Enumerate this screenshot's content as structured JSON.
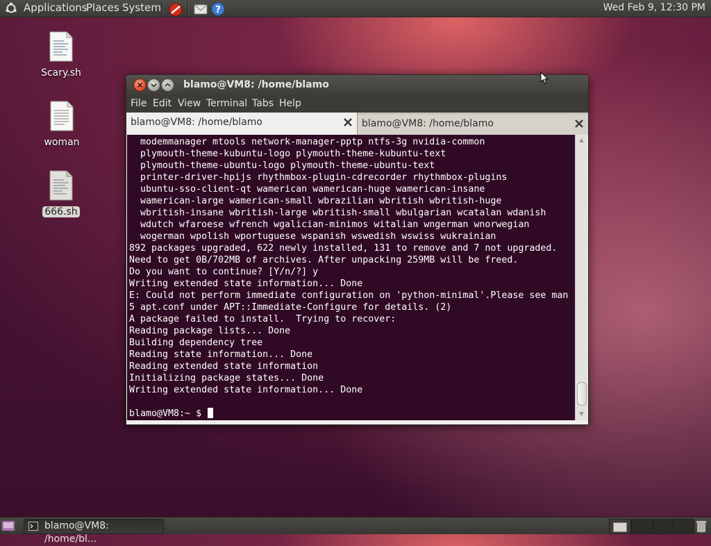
{
  "top_panel": {
    "menus": [
      "Applications",
      "Places",
      "System"
    ],
    "clock": "Wed Feb  9, 12:30 PM",
    "icons": [
      "ubuntu-logo-icon",
      "stop-icon",
      "mail-icon",
      "help-icon"
    ]
  },
  "desktop_icons": [
    {
      "label": "Scary.sh",
      "icon": "script-file-icon"
    },
    {
      "label": "woman",
      "icon": "text-file-icon"
    },
    {
      "label": "666.sh",
      "icon": "script-file-icon",
      "selected": true
    }
  ],
  "terminal_window": {
    "title": "blamo@VM8: /home/blamo",
    "menubar": [
      "File",
      "Edit",
      "View",
      "Terminal",
      "Tabs",
      "Help"
    ],
    "tabs": [
      {
        "label": "blamo@VM8: /home/blamo",
        "active": true
      },
      {
        "label": "blamo@VM8: /home/blamo",
        "active": false
      }
    ],
    "lines": [
      "  modemmanager mtools network-manager-pptp ntfs-3g nvidia-common",
      "  plymouth-theme-kubuntu-logo plymouth-theme-kubuntu-text",
      "  plymouth-theme-ubuntu-logo plymouth-theme-ubuntu-text",
      "  printer-driver-hpijs rhythmbox-plugin-cdrecorder rhythmbox-plugins",
      "  ubuntu-sso-client-qt wamerican wamerican-huge wamerican-insane",
      "  wamerican-large wamerican-small wbrazilian wbritish wbritish-huge",
      "  wbritish-insane wbritish-large wbritish-small wbulgarian wcatalan wdanish",
      "  wdutch wfaroese wfrench wgalician-minimos witalian wngerman wnorwegian",
      "  wogerman wpolish wportuguese wspanish wswedish wswiss wukrainian",
      "892 packages upgraded, 622 newly installed, 131 to remove and 7 not upgraded.",
      "Need to get 0B/702MB of archives. After unpacking 259MB will be freed.",
      "Do you want to continue? [Y/n/?] y",
      "Writing extended state information... Done",
      "E: Could not perform immediate configuration on 'python-minimal'.Please see man",
      "5 apt.conf under APT::Immediate-Configure for details. (2)",
      "A package failed to install.  Trying to recover:",
      "Reading package lists... Done",
      "Building dependency tree",
      "Reading state information... Done",
      "Reading extended state information",
      "Initializing package states... Done",
      "Writing extended state information... Done",
      ""
    ],
    "prompt": "blamo@VM8:~ $ "
  },
  "bottom_panel": {
    "task_label": "blamo@VM8: /home/bl...",
    "icons": [
      "show-desktop-icon",
      "terminal-icon",
      "trash-icon"
    ]
  },
  "colors": {
    "terminal_bg": "#300a24",
    "terminal_fg": "#ffffff",
    "panel_bg": "#3c3b37"
  }
}
